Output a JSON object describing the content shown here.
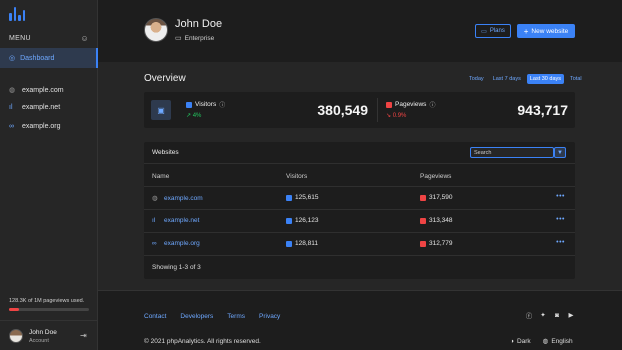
{
  "sidebar": {
    "menu_label": "MENU",
    "dashboard_label": "Dashboard",
    "sites": [
      {
        "label": "example.com",
        "icon": "globe-icon"
      },
      {
        "label": "example.net",
        "icon": "bar-chart-icon"
      },
      {
        "label": "example.org",
        "icon": "link-icon"
      }
    ],
    "usage_text": "128.3K of 1M pageviews used.",
    "usage_fraction": 0.128,
    "user_name": "John Doe",
    "user_role": "Account"
  },
  "header": {
    "name": "John Doe",
    "plan": "Enterprise",
    "plans_button": "Plans",
    "new_website_button": "New website"
  },
  "overview": {
    "title": "Overview",
    "ranges": [
      "Today",
      "Last 7 days",
      "Last 30 days",
      "Total"
    ],
    "active_range": "Last 30 days",
    "visitors": {
      "label": "Visitors",
      "change": "4%",
      "value": "380,549",
      "color": "#3b82f6"
    },
    "pageviews": {
      "label": "Pageviews",
      "change": "0.9%",
      "value": "943,717",
      "color": "#ef4444"
    }
  },
  "websites": {
    "title": "Websites",
    "search_placeholder": "Search",
    "columns": [
      "Name",
      "Visitors",
      "Pageviews"
    ],
    "rows": [
      {
        "name": "example.com",
        "icon": "globe-icon",
        "visitors": "125,615",
        "pageviews": "317,590"
      },
      {
        "name": "example.net",
        "icon": "bar-chart-icon",
        "visitors": "126,123",
        "pageviews": "313,348"
      },
      {
        "name": "example.org",
        "icon": "link-icon",
        "visitors": "128,811",
        "pageviews": "312,779"
      }
    ],
    "showing": "Showing 1-3 of 3"
  },
  "footer": {
    "links": [
      "Contact",
      "Developers",
      "Terms",
      "Privacy"
    ],
    "socials": [
      "facebook-icon",
      "twitter-icon",
      "instagram-icon",
      "youtube-icon"
    ],
    "copyright": "© 2021 phpAnalytics. All rights reserved.",
    "theme_label": "Dark",
    "language_label": "English"
  }
}
